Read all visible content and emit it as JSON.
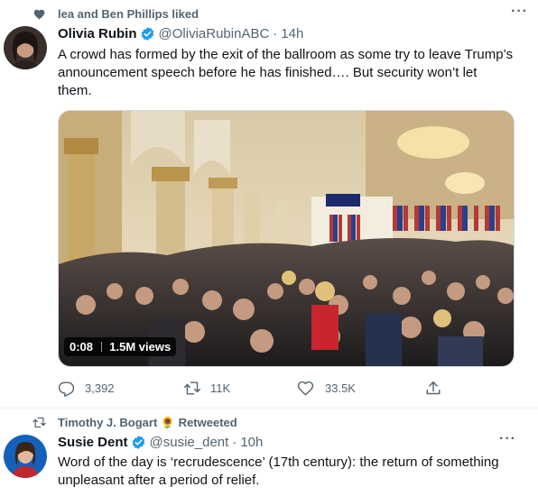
{
  "tweet1": {
    "social_context": "lea and Ben Phillips liked",
    "author_name": "Olivia Rubin",
    "handle": "@OliviaRubinABC",
    "time": "14h",
    "text_line1": "A crowd has formed by the exit of the ballroom as some try to leave Trump’s",
    "text_line2": "announcement speech before he has finished…. But security won’t let",
    "text_line3": "them.",
    "video": {
      "duration": "0:08",
      "views": "1.5M views"
    },
    "actions": {
      "replies": "3,392",
      "retweets": "11K",
      "likes": "33.5K"
    }
  },
  "tweet2": {
    "social_context": "Timothy J. Bogart 🌻 Retweeted",
    "author_name": "Susie Dent",
    "handle": "@susie_dent",
    "time": "10h",
    "text_line1": "Word of the day is ‘recrudescence’ (17th century): the return of something",
    "text_line2": "unpleasant after a period of relief."
  },
  "colors": {
    "text": "#0f1419",
    "secondary": "#536471",
    "verified": "#1d9bf0",
    "divider": "#eff3f4"
  },
  "icons": [
    "heart-icon",
    "verified-badge-icon",
    "more-icon",
    "reply-icon",
    "retweet-icon",
    "like-icon",
    "share-icon"
  ]
}
